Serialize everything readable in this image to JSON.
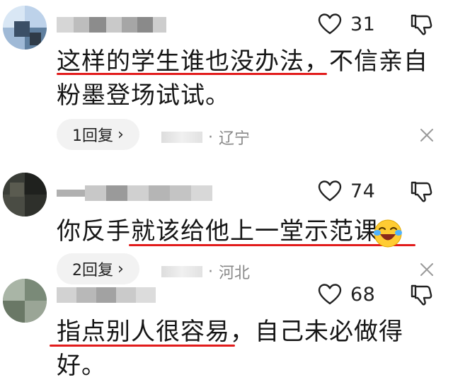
{
  "comments": [
    {
      "likes": "31",
      "text_line1": "这样的学生谁也没办法，不信亲自",
      "text_line2": "粉墨登场试试。",
      "reply_label": "1回复",
      "reply_chevron": "›",
      "meta_dot": "·",
      "location": "辽宁"
    },
    {
      "likes": "74",
      "text_line1": "你反手就该给他上一堂示范课",
      "reply_label": "2回复",
      "reply_chevron": "›",
      "meta_dot": "·",
      "location": "河北"
    },
    {
      "likes": "68",
      "text_line1": "指点别人很容易，自己未必做得",
      "text_line2": "好。"
    }
  ],
  "colors": {
    "underline": "#e21b1b",
    "reply_bg": "#f2f2f2",
    "meta_text": "#888888"
  },
  "icons": {
    "like": "heart-outline-icon",
    "dislike": "thumbs-down-icon",
    "close": "close-x-icon",
    "emoji": "laughing-crying-emoji-icon"
  }
}
